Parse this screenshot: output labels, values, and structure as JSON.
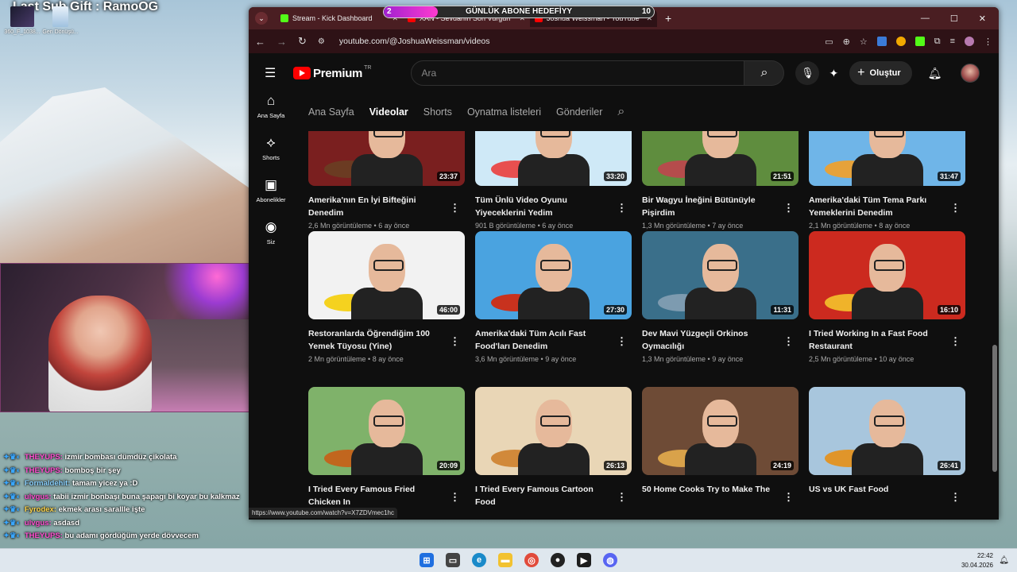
{
  "stream": {
    "title": "Last Sub Gift : RamoOG",
    "goal": {
      "label": "GÜNLÜK ABONE HEDEFİYY",
      "current": "2",
      "target": "10",
      "progress": 0.2
    }
  },
  "desktop": {
    "icons": [
      {
        "label": "360_F_1038...",
        "icon": "image-thumbnail-icon"
      },
      {
        "label": "Geri Dönüşü...",
        "icon": "recycle-bin-icon"
      }
    ]
  },
  "chat": [
    {
      "user": "THEYUPS:",
      "text": "izmir bombası dümdüz çikolata",
      "color": "pink"
    },
    {
      "user": "THEYUPS:",
      "text": "bomboş bir şey",
      "color": "pink"
    },
    {
      "user": "Formaldehit:",
      "text": "tamam yicez ya :D",
      "color": "blue"
    },
    {
      "user": "ulvgus:",
      "text": "tabii izmir bonbaşı buna şapagı bi koyar bu kalkmaz",
      "color": "pink"
    },
    {
      "user": "Fyrodex:",
      "text": "ekmek arası sarallle işte",
      "color": "yellow"
    },
    {
      "user": "ulvgus:",
      "text": "asdasd",
      "color": "pink"
    },
    {
      "user": "THEYUPS:",
      "text": "bu adamı gördüğüm yerde dövvecem",
      "color": "pink"
    }
  ],
  "browser": {
    "tabs": [
      {
        "label": "Stream - Kick Dashboard",
        "color": "#53fc18"
      },
      {
        "label": "XAN - Sevdanın Son Vurgun",
        "color": "#ff0000"
      },
      {
        "label": "Joshua Weissman - YouTube",
        "color": "#ff0000"
      }
    ],
    "url": "youtube.com/@JoshuaWeissman/videos",
    "status_url": "https://www.youtube.com/watch?v=X7ZDVmec1hc"
  },
  "youtube": {
    "brand": "Premium",
    "region": "TR",
    "search_placeholder": "Ara",
    "create_label": "Oluştur",
    "sidenav": [
      {
        "label": "Ana Sayfa",
        "icon": "home-icon"
      },
      {
        "label": "Shorts",
        "icon": "shorts-icon"
      },
      {
        "label": "Abonelikler",
        "icon": "subscriptions-icon"
      },
      {
        "label": "Siz",
        "icon": "user-icon"
      }
    ],
    "channel_tabs": [
      "Ana Sayfa",
      "Videolar",
      "Shorts",
      "Oynatma listeleri",
      "Gönderiler"
    ],
    "active_tab": "Videolar",
    "videos": [
      {
        "title": "Amerika'nın En İyi Bifteğini Denedim",
        "views": "2,6 Mn görüntüleme",
        "age": "6 ay önce",
        "duration": "23:37",
        "bg": "#7a1f1f",
        "food": "#6b3b22"
      },
      {
        "title": "Tüm Ünlü Video Oyunu Yiyeceklerini Yedim",
        "views": "901 B görüntüleme",
        "age": "6 ay önce",
        "duration": "33:20",
        "bg": "#cfe9f7",
        "food": "#e84f4f"
      },
      {
        "title": "Bir Wagyu İneğini Bütünüyle Pişirdim",
        "views": "1,3 Mn görüntüleme",
        "age": "7 ay önce",
        "duration": "21:51",
        "bg": "#5f8d3e",
        "food": "#b54c4c"
      },
      {
        "title": "Amerika'daki Tüm Tema Parkı Yemeklerini Denedim",
        "views": "2,1 Mn görüntüleme",
        "age": "8 ay önce",
        "duration": "31:47",
        "bg": "#6fb5e8",
        "food": "#e6a23a"
      },
      {
        "title": "Restoranlarda Öğrendiğim 100 Yemek Tüyosu (Yine)",
        "views": "2 Mn görüntüleme",
        "age": "8 ay önce",
        "duration": "46:00",
        "bg": "#f2f2f2",
        "food": "#f5d21f"
      },
      {
        "title": "Amerika'daki Tüm Acılı Fast Food'ları Denedim",
        "views": "3,6 Mn görüntüleme",
        "age": "9 ay önce",
        "duration": "27:30",
        "bg": "#4aa3e0",
        "food": "#c8321e"
      },
      {
        "title": "Dev Mavi Yüzgeçli Orkinos Oymacılığı",
        "views": "1,3 Mn görüntüleme",
        "age": "9 ay önce",
        "duration": "11:31",
        "bg": "#3a6f8a",
        "food": "#7d9bb0"
      },
      {
        "title": "I Tried Working In a Fast Food Restaurant",
        "views": "2,5 Mn görüntüleme",
        "age": "10 ay önce",
        "duration": "16:10",
        "bg": "#cc2a1f",
        "food": "#f0b32a"
      },
      {
        "title": "I Tried Every Famous Fried Chicken In",
        "views": "",
        "age": "",
        "duration": "20:09",
        "bg": "#7fb26a",
        "food": "#c1661e"
      },
      {
        "title": "I Tried Every Famous Cartoon Food",
        "views": "",
        "age": "",
        "duration": "26:13",
        "bg": "#e9d6b6",
        "food": "#d1893a"
      },
      {
        "title": "50 Home Cooks Try to Make The",
        "views": "",
        "age": "",
        "duration": "24:19",
        "bg": "#6e4b36",
        "food": "#d9a24a"
      },
      {
        "title": "US vs UK Fast Food",
        "views": "",
        "age": "",
        "duration": "26:41",
        "bg": "#a8c6dd",
        "food": "#e0952a"
      }
    ]
  },
  "taskbar": {
    "time": "22:42",
    "date": "30.04.2026"
  }
}
